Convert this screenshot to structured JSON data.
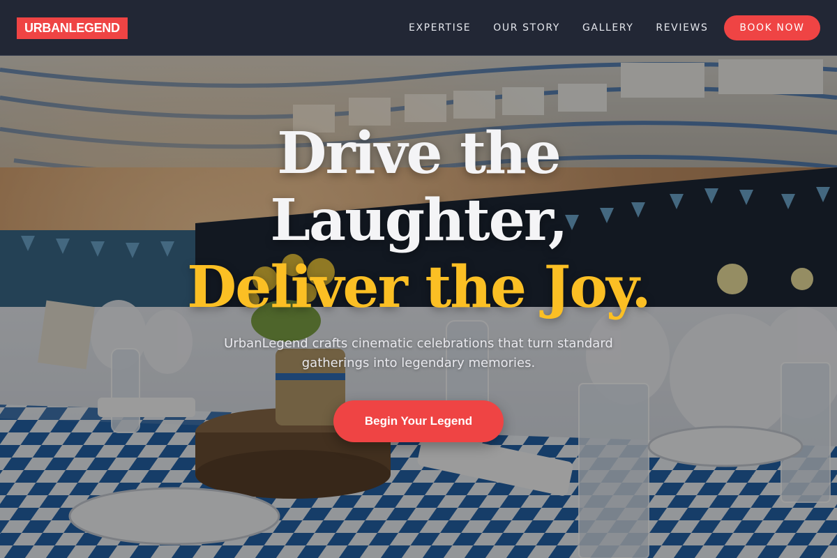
{
  "header": {
    "logo": "URBANLEGEND",
    "nav": [
      {
        "label": "EXPERTISE"
      },
      {
        "label": "OUR STORY"
      },
      {
        "label": "GALLERY"
      },
      {
        "label": "REVIEWS"
      }
    ],
    "book_label": "BOOK NOW"
  },
  "hero": {
    "headline_line1": "Drive the",
    "headline_line2": "Laughter,",
    "headline_line3": "Deliver the Joy.",
    "subtext": "UrbanLegend crafts cinematic celebrations that turn standard gatherings into legendary memories.",
    "cta_label": "Begin Your Legend",
    "background_image": "banquet-hall-photo"
  },
  "colors": {
    "brand_red": "#ef4444",
    "accent_yellow": "#fbbf24",
    "navbar_bg": "#222735",
    "tablecloth_blue": "#2563a8"
  }
}
